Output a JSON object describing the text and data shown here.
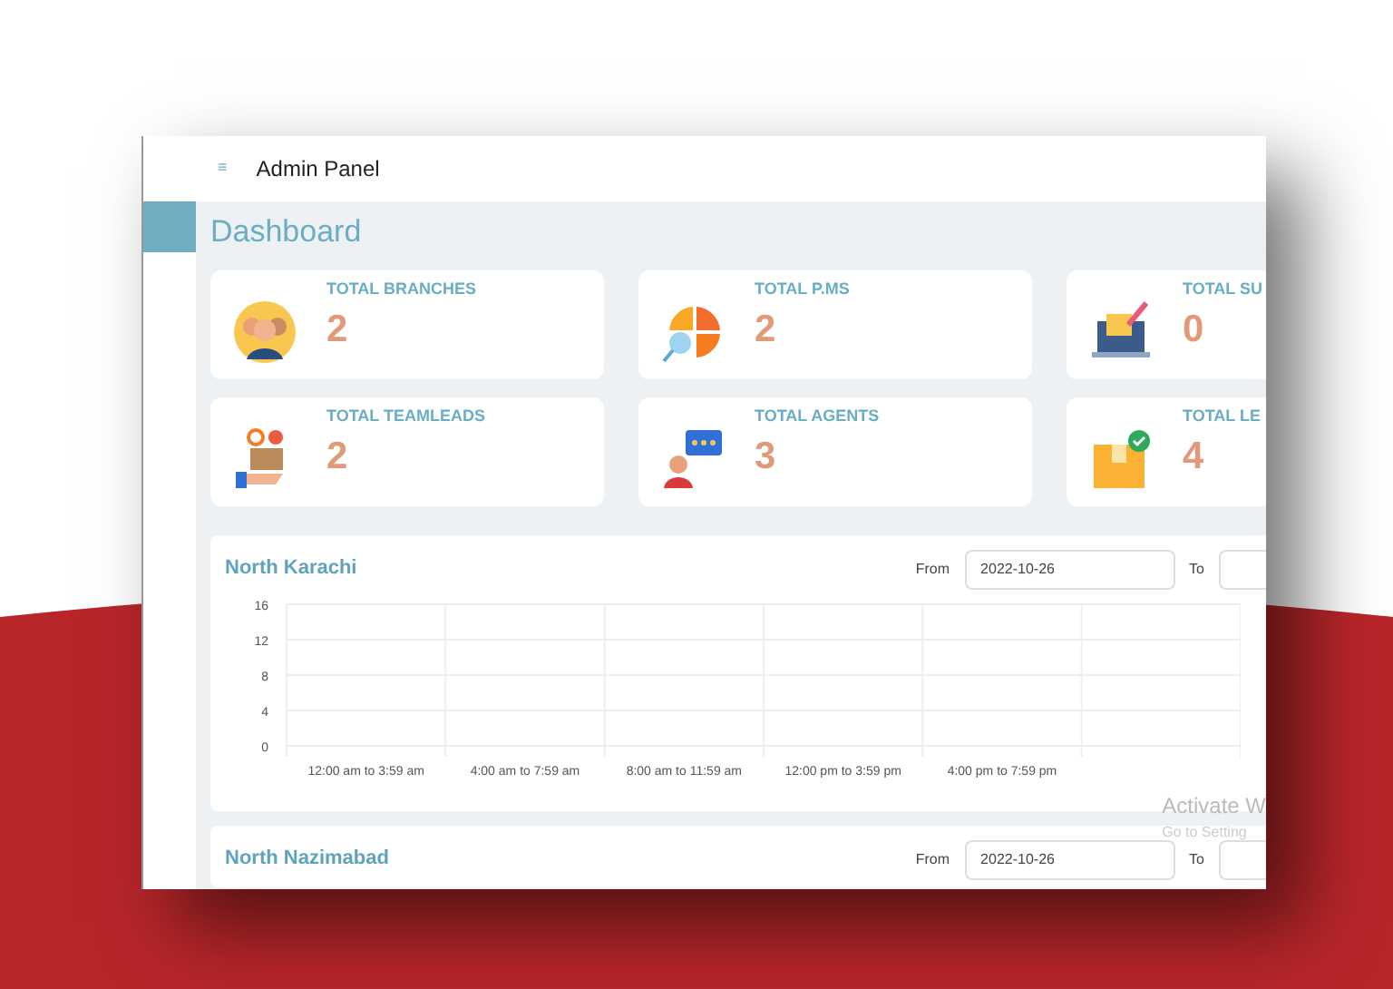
{
  "header": {
    "menu_icon": "≡",
    "title": "Admin Panel"
  },
  "sidebar": {
    "items": [
      {
        "selected": true
      }
    ]
  },
  "page_title": "Dashboard",
  "cards": [
    {
      "kind": "team",
      "label": "TOTAL BRANCHES",
      "value": "2"
    },
    {
      "kind": "pie",
      "label": "TOTAL P.MS",
      "value": "2"
    },
    {
      "kind": "laptop",
      "label": "TOTAL SU",
      "value": "0"
    },
    {
      "kind": "box-hand",
      "label": "TOTAL TEAMLEADS",
      "value": "2"
    },
    {
      "kind": "agent",
      "label": "TOTAL AGENTS",
      "value": "3"
    },
    {
      "kind": "package",
      "label": "TOTAL LE",
      "value": "4"
    }
  ],
  "panels": [
    {
      "title": "North Karachi",
      "from_label": "From",
      "from_value": "2022-10-26",
      "to_label": "To",
      "chart_data": {
        "type": "line",
        "grid": true,
        "categories": [
          "12:00 am to 3:59 am",
          "4:00 am to 7:59 am",
          "8:00 am to 11:59 am",
          "12:00 pm to 3:59 pm",
          "4:00 pm to 7:59 pm"
        ],
        "ylim": [
          0,
          16
        ],
        "yticks": [
          0,
          4,
          8,
          12,
          16
        ]
      }
    },
    {
      "title": "North Nazimabad",
      "from_label": "From",
      "from_value": "2022-10-26",
      "to_label": "To"
    }
  ],
  "watermark_lines": [
    "Activate W",
    "Go to Setting"
  ]
}
